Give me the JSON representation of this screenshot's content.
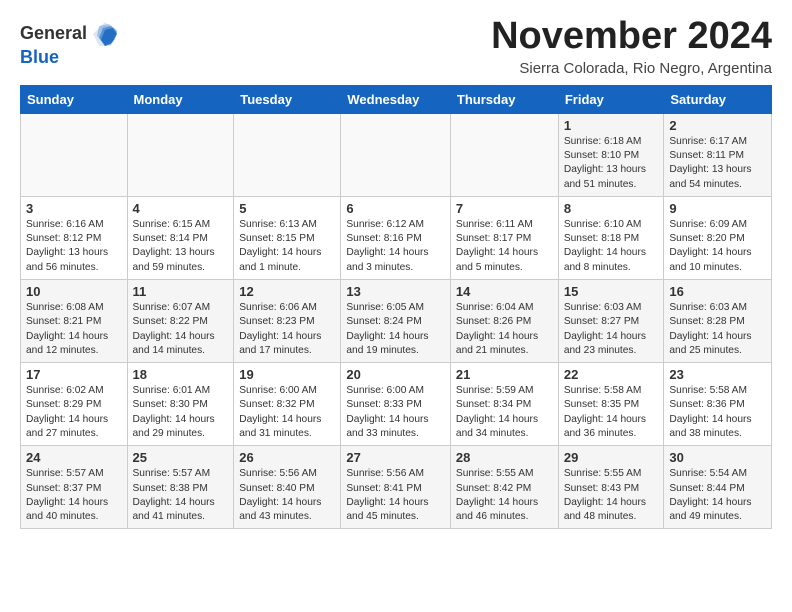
{
  "header": {
    "logo_general": "General",
    "logo_blue": "Blue",
    "month_title": "November 2024",
    "location": "Sierra Colorada, Rio Negro, Argentina"
  },
  "days_of_week": [
    "Sunday",
    "Monday",
    "Tuesday",
    "Wednesday",
    "Thursday",
    "Friday",
    "Saturday"
  ],
  "weeks": [
    [
      {
        "day": "",
        "info": ""
      },
      {
        "day": "",
        "info": ""
      },
      {
        "day": "",
        "info": ""
      },
      {
        "day": "",
        "info": ""
      },
      {
        "day": "",
        "info": ""
      },
      {
        "day": "1",
        "info": "Sunrise: 6:18 AM\nSunset: 8:10 PM\nDaylight: 13 hours\nand 51 minutes."
      },
      {
        "day": "2",
        "info": "Sunrise: 6:17 AM\nSunset: 8:11 PM\nDaylight: 13 hours\nand 54 minutes."
      }
    ],
    [
      {
        "day": "3",
        "info": "Sunrise: 6:16 AM\nSunset: 8:12 PM\nDaylight: 13 hours\nand 56 minutes."
      },
      {
        "day": "4",
        "info": "Sunrise: 6:15 AM\nSunset: 8:14 PM\nDaylight: 13 hours\nand 59 minutes."
      },
      {
        "day": "5",
        "info": "Sunrise: 6:13 AM\nSunset: 8:15 PM\nDaylight: 14 hours\nand 1 minute."
      },
      {
        "day": "6",
        "info": "Sunrise: 6:12 AM\nSunset: 8:16 PM\nDaylight: 14 hours\nand 3 minutes."
      },
      {
        "day": "7",
        "info": "Sunrise: 6:11 AM\nSunset: 8:17 PM\nDaylight: 14 hours\nand 5 minutes."
      },
      {
        "day": "8",
        "info": "Sunrise: 6:10 AM\nSunset: 8:18 PM\nDaylight: 14 hours\nand 8 minutes."
      },
      {
        "day": "9",
        "info": "Sunrise: 6:09 AM\nSunset: 8:20 PM\nDaylight: 14 hours\nand 10 minutes."
      }
    ],
    [
      {
        "day": "10",
        "info": "Sunrise: 6:08 AM\nSunset: 8:21 PM\nDaylight: 14 hours\nand 12 minutes."
      },
      {
        "day": "11",
        "info": "Sunrise: 6:07 AM\nSunset: 8:22 PM\nDaylight: 14 hours\nand 14 minutes."
      },
      {
        "day": "12",
        "info": "Sunrise: 6:06 AM\nSunset: 8:23 PM\nDaylight: 14 hours\nand 17 minutes."
      },
      {
        "day": "13",
        "info": "Sunrise: 6:05 AM\nSunset: 8:24 PM\nDaylight: 14 hours\nand 19 minutes."
      },
      {
        "day": "14",
        "info": "Sunrise: 6:04 AM\nSunset: 8:26 PM\nDaylight: 14 hours\nand 21 minutes."
      },
      {
        "day": "15",
        "info": "Sunrise: 6:03 AM\nSunset: 8:27 PM\nDaylight: 14 hours\nand 23 minutes."
      },
      {
        "day": "16",
        "info": "Sunrise: 6:03 AM\nSunset: 8:28 PM\nDaylight: 14 hours\nand 25 minutes."
      }
    ],
    [
      {
        "day": "17",
        "info": "Sunrise: 6:02 AM\nSunset: 8:29 PM\nDaylight: 14 hours\nand 27 minutes."
      },
      {
        "day": "18",
        "info": "Sunrise: 6:01 AM\nSunset: 8:30 PM\nDaylight: 14 hours\nand 29 minutes."
      },
      {
        "day": "19",
        "info": "Sunrise: 6:00 AM\nSunset: 8:32 PM\nDaylight: 14 hours\nand 31 minutes."
      },
      {
        "day": "20",
        "info": "Sunrise: 6:00 AM\nSunset: 8:33 PM\nDaylight: 14 hours\nand 33 minutes."
      },
      {
        "day": "21",
        "info": "Sunrise: 5:59 AM\nSunset: 8:34 PM\nDaylight: 14 hours\nand 34 minutes."
      },
      {
        "day": "22",
        "info": "Sunrise: 5:58 AM\nSunset: 8:35 PM\nDaylight: 14 hours\nand 36 minutes."
      },
      {
        "day": "23",
        "info": "Sunrise: 5:58 AM\nSunset: 8:36 PM\nDaylight: 14 hours\nand 38 minutes."
      }
    ],
    [
      {
        "day": "24",
        "info": "Sunrise: 5:57 AM\nSunset: 8:37 PM\nDaylight: 14 hours\nand 40 minutes."
      },
      {
        "day": "25",
        "info": "Sunrise: 5:57 AM\nSunset: 8:38 PM\nDaylight: 14 hours\nand 41 minutes."
      },
      {
        "day": "26",
        "info": "Sunrise: 5:56 AM\nSunset: 8:40 PM\nDaylight: 14 hours\nand 43 minutes."
      },
      {
        "day": "27",
        "info": "Sunrise: 5:56 AM\nSunset: 8:41 PM\nDaylight: 14 hours\nand 45 minutes."
      },
      {
        "day": "28",
        "info": "Sunrise: 5:55 AM\nSunset: 8:42 PM\nDaylight: 14 hours\nand 46 minutes."
      },
      {
        "day": "29",
        "info": "Sunrise: 5:55 AM\nSunset: 8:43 PM\nDaylight: 14 hours\nand 48 minutes."
      },
      {
        "day": "30",
        "info": "Sunrise: 5:54 AM\nSunset: 8:44 PM\nDaylight: 14 hours\nand 49 minutes."
      }
    ]
  ]
}
